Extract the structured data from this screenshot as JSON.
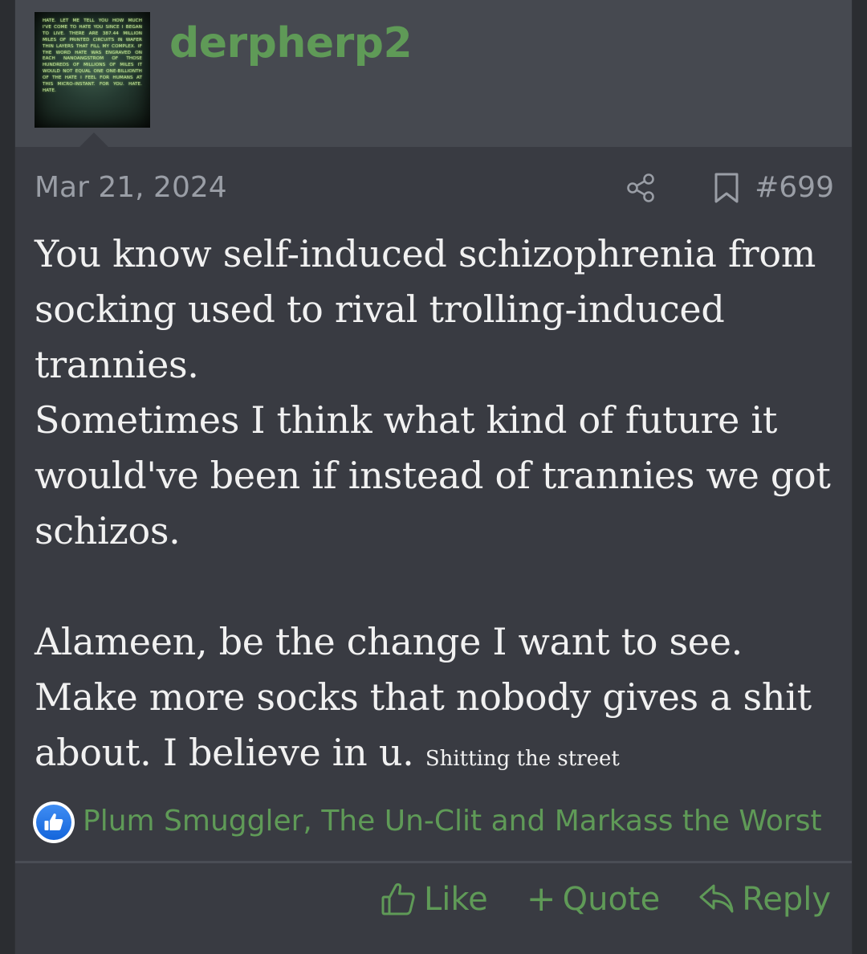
{
  "user": {
    "name": "derpherp2",
    "avatar_text": "HATE. LET ME TELL YOU HOW MUCH I'VE COME TO HATE YOU SINCE I BEGAN TO LIVE. THERE ARE 387.44 MILLION MILES OF PRINTED CIRCUITS IN WAFER THIN LAYERS THAT FILL MY COMPLEX. IF THE WORD HATE WAS ENGRAVED ON EACH NANOANGSTROM OF THOSE HUNDREDS OF MILLIONS OF MILES IT WOULD NOT EQUAL ONE ONE-BILLIONTH OF THE HATE I FEEL FOR HUMANS AT THIS MICRO-INSTANT. FOR YOU. HATE. HATE."
  },
  "post": {
    "date": "Mar 21, 2024",
    "number": "#699",
    "paragraphs": [
      "You know self-induced schizophrenia from socking used to rival trolling-induced trannies.",
      "Sometimes I think what kind of future it would've been if instead of trannies we got schizos."
    ],
    "last_paragraph": "Alameen, be the change I want to see. Make more socks that nobody gives a shit about. I believe in u.",
    "trailing_small_text": "Shitting the street"
  },
  "reactions": {
    "icon": "thumbs-up-icon",
    "users_text": "Plum Smuggler, The Un-Clit and Markass the Worst"
  },
  "actions": {
    "like_label": "Like",
    "quote_label": "Quote",
    "reply_label": "Reply"
  },
  "colors": {
    "background": "#393b42",
    "header": "#464950",
    "accent_green": "#5f9a57",
    "text": "#f1f1f1",
    "muted": "#9a9ea6",
    "like_blue": "#1877f2"
  }
}
